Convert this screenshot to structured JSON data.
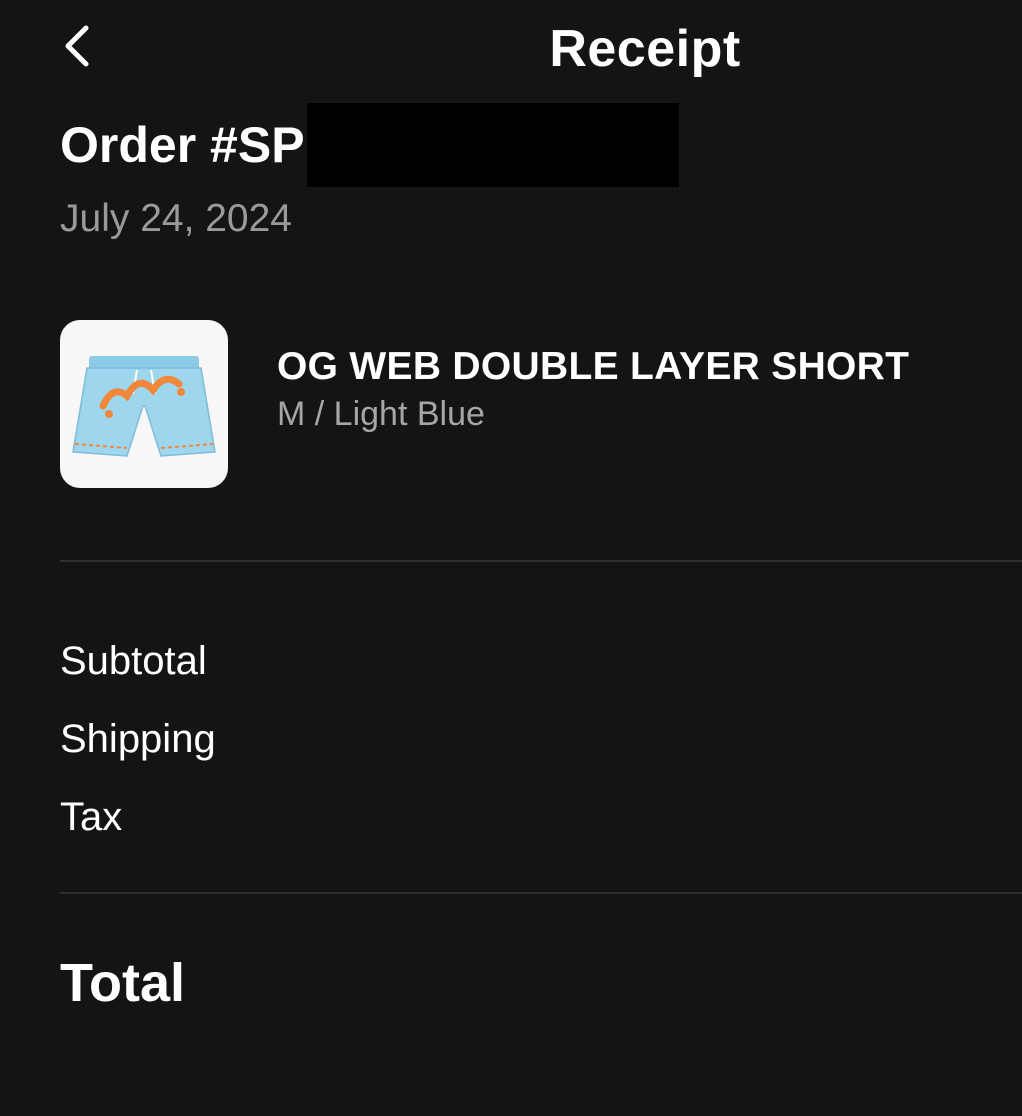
{
  "nav": {
    "back_icon": "chevron-left-icon",
    "title": "Receipt"
  },
  "order": {
    "number_prefix": "Order #SP",
    "date": "July 24, 2024"
  },
  "item": {
    "name": "OG WEB DOUBLE LAYER SHORT",
    "variant": "M / Light Blue",
    "image_colors": {
      "short": "#9ed6ee",
      "logo": "#f0873a"
    }
  },
  "summary": {
    "subtotal_label": "Subtotal",
    "shipping_label": "Shipping",
    "tax_label": "Tax",
    "total_label": "Total"
  },
  "colors": {
    "background": "#141414",
    "text": "#ffffff",
    "secondary_text": "#9a9a9a",
    "divider": "#2e2e2e"
  }
}
